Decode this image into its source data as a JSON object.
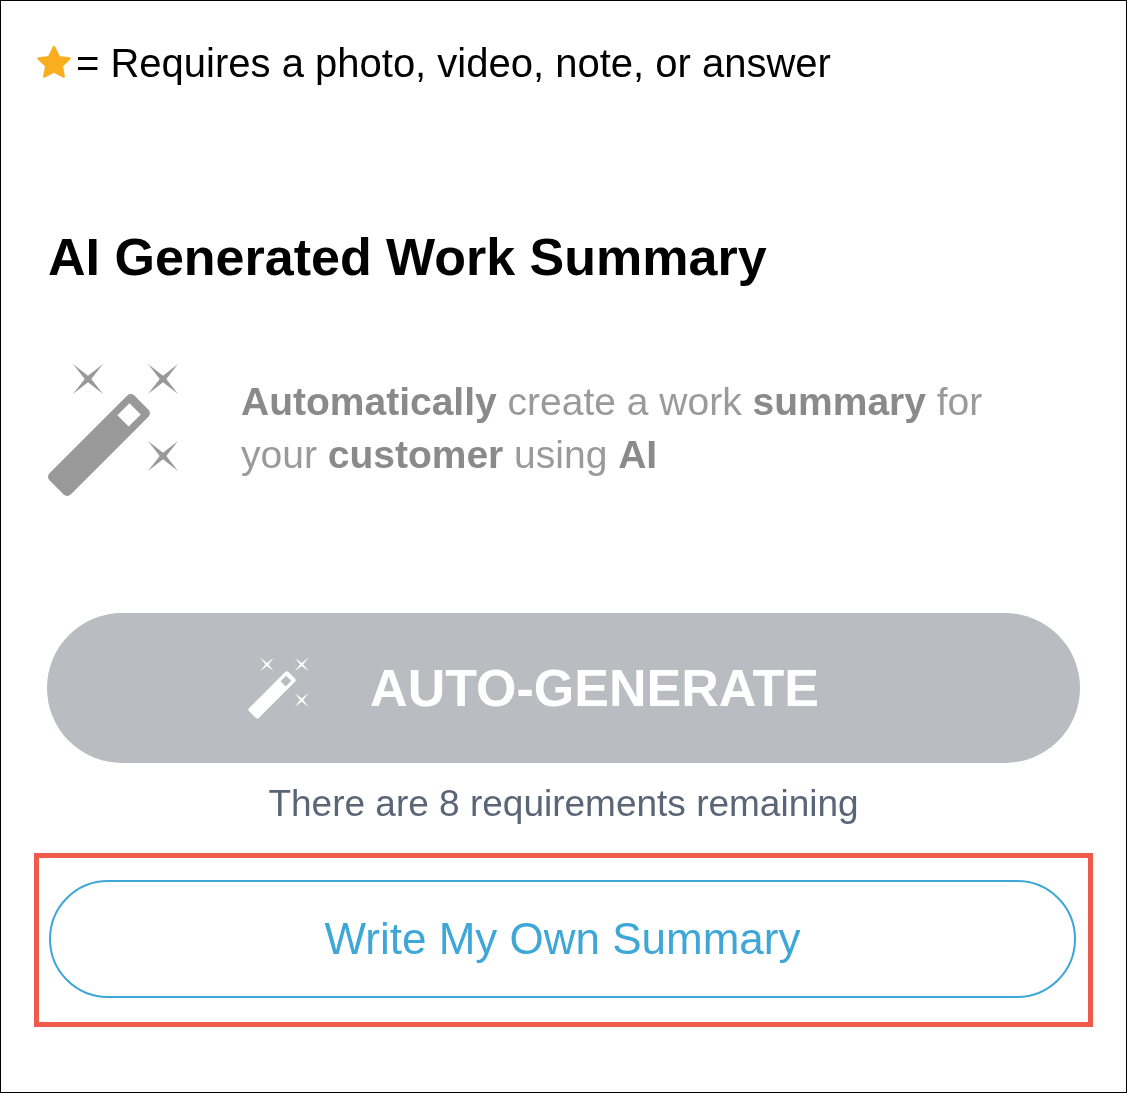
{
  "legend": {
    "text": "= Requires a photo, video, note, or answer"
  },
  "section": {
    "title": "AI Generated Work Summary",
    "description": "**Automatically** create a work **summary** for your **customer** using **AI**"
  },
  "auto_generate_button": {
    "label": "AUTO-GENERATE",
    "disabled": true
  },
  "status": "There are 8 requirements remaining",
  "write_button": {
    "label": "Write My Own Summary",
    "highlighted": true
  }
}
